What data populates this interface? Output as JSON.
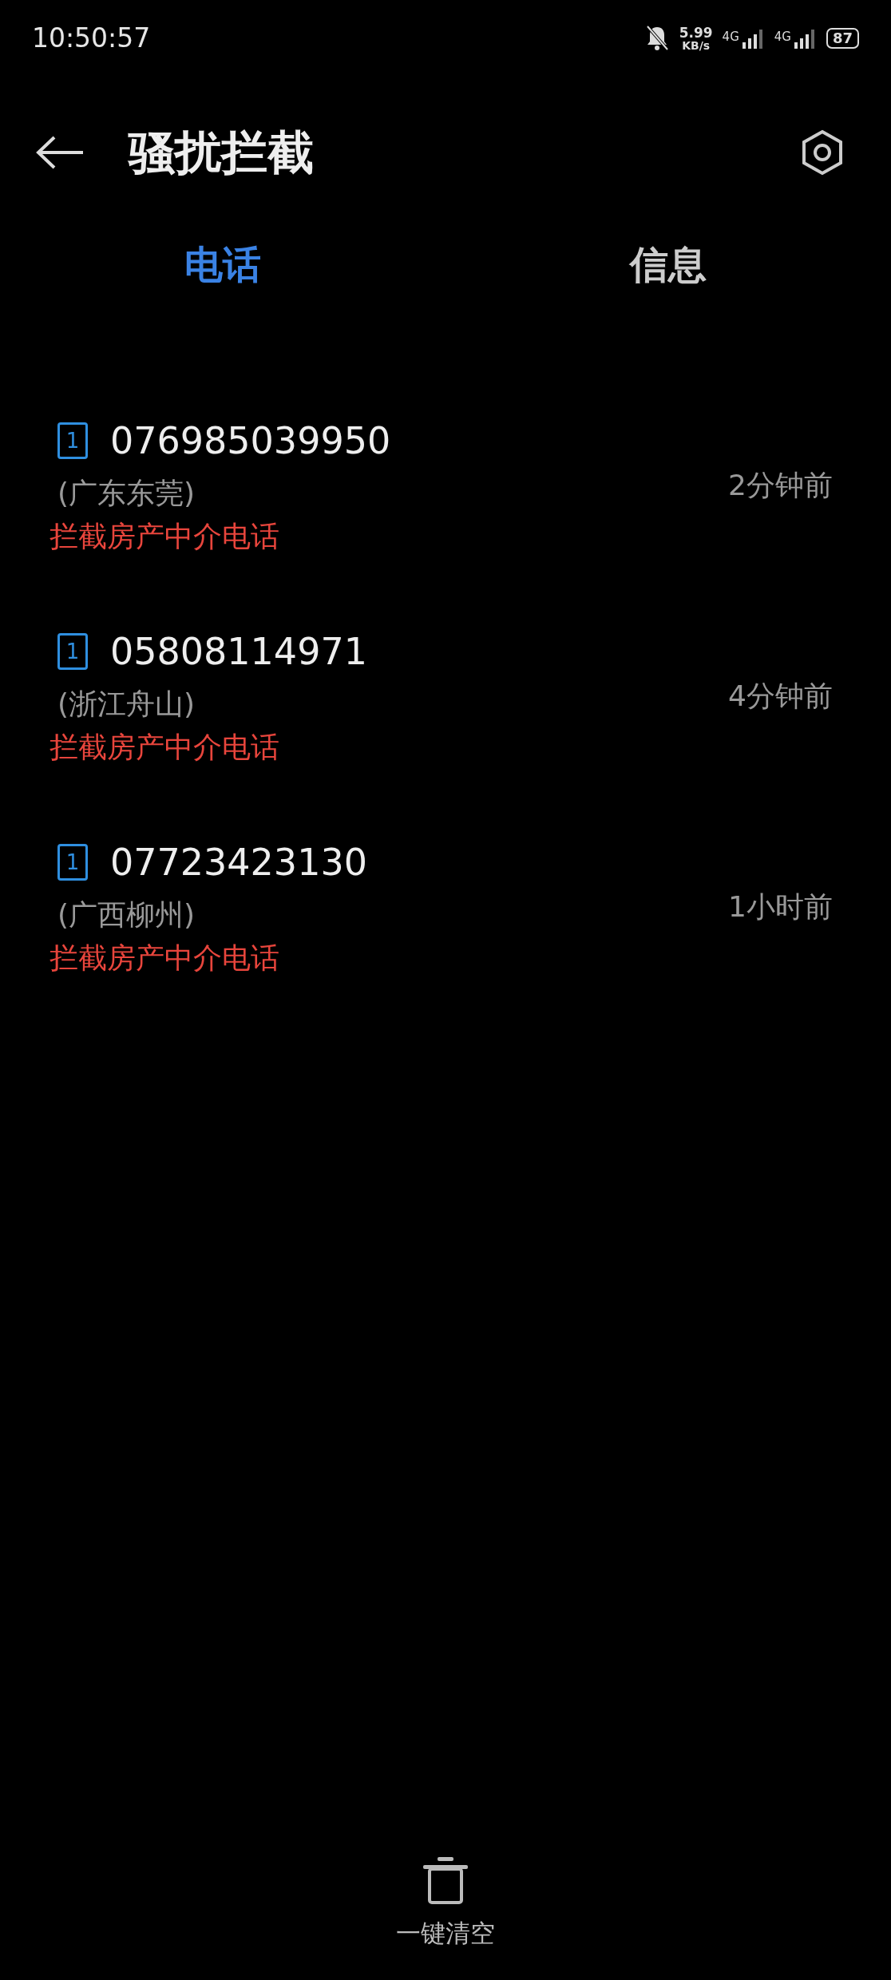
{
  "status_bar": {
    "time": "10:50:57",
    "speed": "5.99",
    "speed_unit": "KB/s",
    "network_1": "4G",
    "network_2": "4G",
    "battery": "87"
  },
  "header": {
    "title": "骚扰拦截"
  },
  "tabs": [
    {
      "label": "电话",
      "selected": true
    },
    {
      "label": "信息",
      "selected": false
    }
  ],
  "calls": [
    {
      "sim": "1",
      "number": "076985039950",
      "location": "(广东东莞)",
      "reason": "拦截房产中介电话",
      "time": "2分钟前"
    },
    {
      "sim": "1",
      "number": "05808114971",
      "location": "(浙江舟山)",
      "reason": "拦截房产中介电话",
      "time": "4分钟前"
    },
    {
      "sim": "1",
      "number": "07723423130",
      "location": "(广西柳州)",
      "reason": "拦截房产中介电话",
      "time": "1小时前"
    }
  ],
  "bottom_action": {
    "label": "一键清空"
  }
}
